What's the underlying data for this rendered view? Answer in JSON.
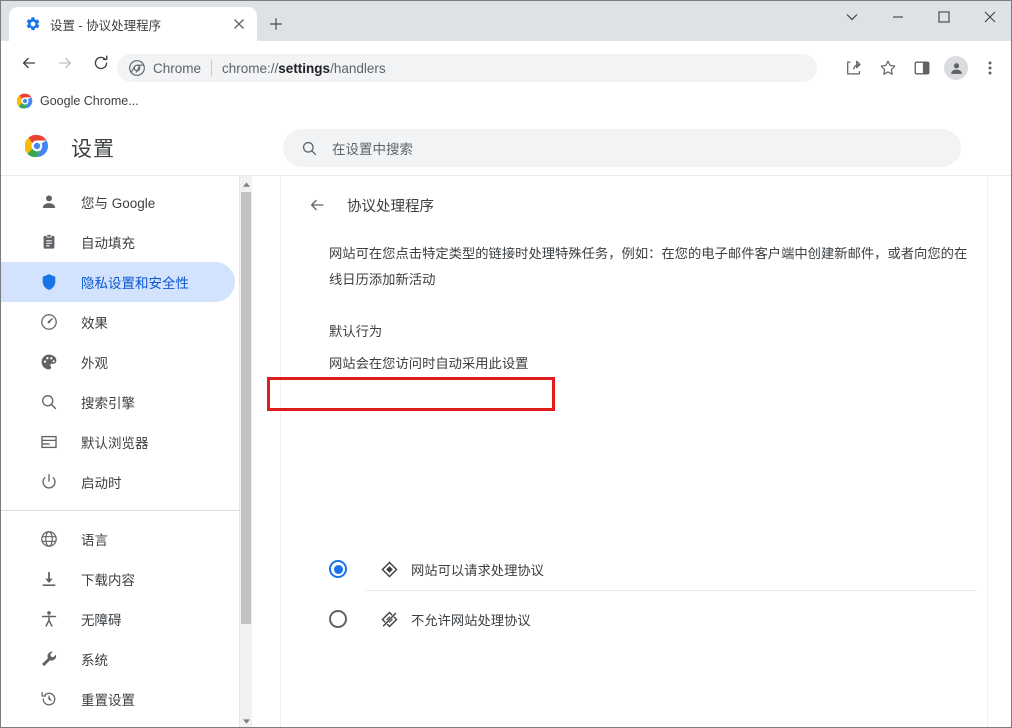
{
  "window": {
    "controls": [
      {
        "name": "tab-search-button",
        "glyph": "chevron-down"
      },
      {
        "name": "minimize-button",
        "glyph": "minimize"
      },
      {
        "name": "maximize-button",
        "glyph": "maximize"
      },
      {
        "name": "close-button",
        "glyph": "close"
      }
    ]
  },
  "tabstrip": {
    "tab": {
      "title": "设置 - 协议处理程序",
      "favicon": "settings-gear-icon",
      "close_icon": "close-icon"
    },
    "new_tab_label": "+",
    "new_tab_icon": "plus-icon"
  },
  "toolbar": {
    "back_icon": "back-arrow-icon",
    "forward_icon": "forward-arrow-icon",
    "reload_icon": "reload-icon",
    "omnibox": {
      "site_icon": "chrome-logo-icon",
      "site_label": "Chrome",
      "url_prefix": "chrome://",
      "url_bold": "settings",
      "url_suffix": "/handlers"
    },
    "right_icons": [
      {
        "name": "share-icon"
      },
      {
        "name": "bookmark-star-icon"
      },
      {
        "name": "side-panel-icon"
      },
      {
        "name": "profile-avatar-icon"
      },
      {
        "name": "more-menu-icon"
      }
    ]
  },
  "bookmark_bar": {
    "items": [
      {
        "label": "Google Chrome...",
        "icon": "chrome-logo-icon"
      }
    ]
  },
  "settings_header": {
    "logo": "chrome-logo-icon",
    "title": "设置",
    "search": {
      "icon": "search-icon",
      "placeholder": "在设置中搜索",
      "value": ""
    }
  },
  "sidebar": {
    "items": [
      {
        "label": "您与 Google",
        "icon": "person-icon",
        "active": false
      },
      {
        "label": "自动填充",
        "icon": "clipboard-icon",
        "active": false
      },
      {
        "label": "隐私设置和安全性",
        "icon": "shield-icon",
        "active": true
      },
      {
        "label": "效果",
        "icon": "speedometer-icon",
        "active": false
      },
      {
        "label": "外观",
        "icon": "palette-icon",
        "active": false
      },
      {
        "label": "搜索引擎",
        "icon": "search-icon",
        "active": false
      },
      {
        "label": "默认浏览器",
        "icon": "browser-window-icon",
        "active": false
      },
      {
        "label": "启动时",
        "icon": "power-icon",
        "active": false
      },
      {
        "label": "语言",
        "icon": "globe-icon",
        "active": false
      },
      {
        "label": "下载内容",
        "icon": "download-icon",
        "active": false
      },
      {
        "label": "无障碍",
        "icon": "accessibility-icon",
        "active": false
      },
      {
        "label": "系统",
        "icon": "wrench-icon",
        "active": false
      },
      {
        "label": "重置设置",
        "icon": "restore-icon",
        "active": false
      }
    ],
    "scrollbar": {
      "up_icon": "scroll-up-arrow-icon",
      "down_icon": "scroll-down-arrow-icon"
    }
  },
  "main": {
    "back_icon": "back-arrow-icon",
    "title": "协议处理程序",
    "description": "网站可在您点击特定类型的链接时处理特殊任务，例如：在您的电子邮件客户端中创建新邮件，或者向您的在线日历添加新活动",
    "default_behavior_label": "默认行为",
    "default_behavior_sub": "网站会在您访问时自动采用此设置",
    "options": [
      {
        "label": "网站可以请求处理协议",
        "icon": "protocol-handler-icon",
        "selected": true,
        "highlighted": true
      },
      {
        "label": "不允许网站处理协议",
        "icon": "protocol-handler-off-icon",
        "selected": false,
        "highlighted": false
      }
    ]
  },
  "colors": {
    "accent_blue": "#1a73e8",
    "active_pill": "#d3e3fd",
    "active_text": "#0b57d0",
    "annotation_red": "#e01b1b",
    "tabstrip_bg": "#dee1e6",
    "omnibox_bg": "#f1f3f4",
    "text_primary": "#3c4043",
    "text_secondary": "#5f6368"
  }
}
